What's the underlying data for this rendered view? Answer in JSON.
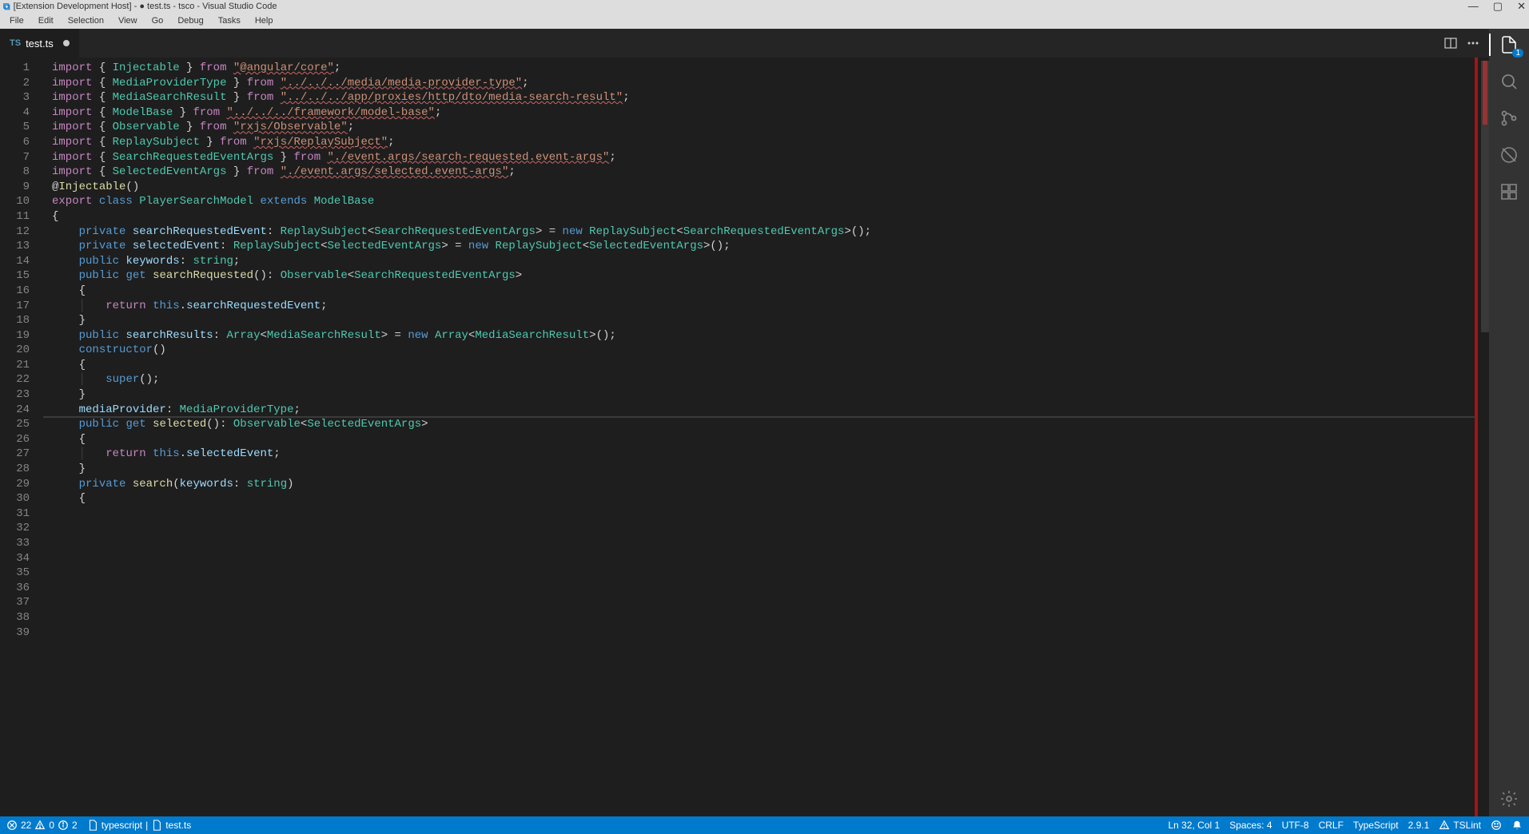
{
  "titlebar": {
    "title": "[Extension Development Host] - ● test.ts - tsco - Visual Studio Code"
  },
  "menubar": {
    "items": [
      "File",
      "Edit",
      "Selection",
      "View",
      "Go",
      "Debug",
      "Tasks",
      "Help"
    ]
  },
  "tabs": {
    "active": {
      "icon": "TS",
      "label": "test.ts",
      "dirty": true
    }
  },
  "activity": {
    "badge": "1"
  },
  "status": {
    "errors": "22",
    "warnings": "0",
    "infos": "2",
    "lang_mode": "typescript",
    "file": "test.ts",
    "cursor": "Ln 32, Col 1",
    "spaces": "Spaces: 4",
    "encoding": "UTF-8",
    "eol": "CRLF",
    "language": "TypeScript",
    "tsversion": "2.9.1",
    "tslint": "TSLint"
  },
  "code": {
    "lines": [
      {
        "n": "1",
        "segs": [
          [
            "kw",
            "import"
          ],
          [
            "pn",
            " { "
          ],
          [
            "cls",
            "Injectable"
          ],
          [
            "pn",
            " } "
          ],
          [
            "kw",
            "from"
          ],
          [
            "pn",
            " "
          ],
          [
            "str wavy",
            "\"@angular/core\""
          ],
          [
            "pn",
            ";"
          ]
        ]
      },
      {
        "n": "2",
        "segs": [
          [
            "kw",
            "import"
          ],
          [
            "pn",
            " { "
          ],
          [
            "cls",
            "MediaProviderType"
          ],
          [
            "pn",
            " } "
          ],
          [
            "kw",
            "from"
          ],
          [
            "pn",
            " "
          ],
          [
            "str wavy",
            "\"../../../media/media-provider-type\""
          ],
          [
            "pn",
            ";"
          ]
        ]
      },
      {
        "n": "3",
        "segs": [
          [
            "kw",
            "import"
          ],
          [
            "pn",
            " { "
          ],
          [
            "cls",
            "MediaSearchResult"
          ],
          [
            "pn",
            " } "
          ],
          [
            "kw",
            "from"
          ],
          [
            "pn",
            " "
          ],
          [
            "str wavy",
            "\"../../../app/proxies/http/dto/media-search-result\""
          ],
          [
            "pn",
            ";"
          ]
        ]
      },
      {
        "n": "4",
        "segs": [
          [
            "kw",
            "import"
          ],
          [
            "pn",
            " { "
          ],
          [
            "cls",
            "ModelBase"
          ],
          [
            "pn",
            " } "
          ],
          [
            "kw",
            "from"
          ],
          [
            "pn",
            " "
          ],
          [
            "str wavy",
            "\"../../../framework/model-base\""
          ],
          [
            "pn",
            ";"
          ]
        ]
      },
      {
        "n": "5",
        "segs": [
          [
            "kw",
            "import"
          ],
          [
            "pn",
            " { "
          ],
          [
            "cls",
            "Observable"
          ],
          [
            "pn",
            " } "
          ],
          [
            "kw",
            "from"
          ],
          [
            "pn",
            " "
          ],
          [
            "str wavy",
            "\"rxjs/Observable\""
          ],
          [
            "pn",
            ";"
          ]
        ]
      },
      {
        "n": "6",
        "segs": [
          [
            "kw",
            "import"
          ],
          [
            "pn",
            " { "
          ],
          [
            "cls",
            "ReplaySubject"
          ],
          [
            "pn",
            " } "
          ],
          [
            "kw",
            "from"
          ],
          [
            "pn",
            " "
          ],
          [
            "str wavy",
            "\"rxjs/ReplaySubject\""
          ],
          [
            "pn",
            ";"
          ]
        ]
      },
      {
        "n": "7",
        "segs": [
          [
            "kw",
            "import"
          ],
          [
            "pn",
            " { "
          ],
          [
            "cls",
            "SearchRequestedEventArgs"
          ],
          [
            "pn",
            " } "
          ],
          [
            "kw",
            "from"
          ],
          [
            "pn",
            " "
          ],
          [
            "str wavy",
            "\"./event.args/search-requested.event-args\""
          ],
          [
            "pn",
            ";"
          ]
        ]
      },
      {
        "n": "8",
        "segs": [
          [
            "kw",
            "import"
          ],
          [
            "pn",
            " { "
          ],
          [
            "cls",
            "SelectedEventArgs"
          ],
          [
            "pn",
            " } "
          ],
          [
            "kw",
            "from"
          ],
          [
            "pn",
            " "
          ],
          [
            "str wavy",
            "\"./event.args/selected.event-args\""
          ],
          [
            "pn",
            ";"
          ]
        ]
      },
      {
        "n": "9",
        "segs": [
          [
            "pn",
            ""
          ]
        ]
      },
      {
        "n": "10",
        "segs": [
          [
            "dec",
            "@"
          ],
          [
            "fn",
            "Injectable"
          ],
          [
            "pn",
            "()"
          ]
        ]
      },
      {
        "n": "11",
        "segs": [
          [
            "kw",
            "export"
          ],
          [
            "pn",
            " "
          ],
          [
            "typekey",
            "class"
          ],
          [
            "pn",
            " "
          ],
          [
            "cls wavy",
            "PlayerSearchModel"
          ],
          [
            "pn",
            " "
          ],
          [
            "typekey",
            "extends"
          ],
          [
            "pn",
            " "
          ],
          [
            "cls",
            "ModelBase"
          ]
        ]
      },
      {
        "n": "12",
        "segs": [
          [
            "pn",
            "{"
          ]
        ]
      },
      {
        "n": "13",
        "segs": [
          [
            "pn",
            "    "
          ],
          [
            "typekey",
            "private"
          ],
          [
            "pn",
            " "
          ],
          [
            "var",
            "searchRequestedEvent"
          ],
          [
            "pn",
            ": "
          ],
          [
            "cls",
            "ReplaySubject"
          ],
          [
            "pn",
            "<"
          ],
          [
            "cls",
            "SearchRequestedEventArgs"
          ],
          [
            "pn",
            "> = "
          ],
          [
            "typekey",
            "new"
          ],
          [
            "pn",
            " "
          ],
          [
            "cls",
            "ReplaySubject"
          ],
          [
            "pn",
            "<"
          ],
          [
            "cls",
            "SearchRequestedEventArgs"
          ],
          [
            "pn",
            ">();"
          ]
        ]
      },
      {
        "n": "14",
        "segs": [
          [
            "pn",
            ""
          ]
        ]
      },
      {
        "n": "15",
        "segs": [
          [
            "pn",
            "    "
          ],
          [
            "typekey",
            "private"
          ],
          [
            "pn",
            " "
          ],
          [
            "var",
            "selectedEvent"
          ],
          [
            "pn",
            ": "
          ],
          [
            "cls",
            "ReplaySubject"
          ],
          [
            "pn",
            "<"
          ],
          [
            "cls",
            "SelectedEventArgs"
          ],
          [
            "pn",
            "> = "
          ],
          [
            "typekey",
            "new"
          ],
          [
            "pn",
            " "
          ],
          [
            "cls",
            "ReplaySubject"
          ],
          [
            "pn",
            "<"
          ],
          [
            "cls",
            "SelectedEventArgs"
          ],
          [
            "pn",
            ">();"
          ]
        ]
      },
      {
        "n": "16",
        "segs": [
          [
            "pn",
            ""
          ]
        ]
      },
      {
        "n": "17",
        "segs": [
          [
            "pn",
            "    "
          ],
          [
            "typekey",
            "public"
          ],
          [
            "pn",
            " "
          ],
          [
            "var",
            "keywords"
          ],
          [
            "pn",
            ": "
          ],
          [
            "cls",
            "string"
          ],
          [
            "pn",
            ";"
          ]
        ]
      },
      {
        "n": "18",
        "segs": [
          [
            "pn",
            ""
          ]
        ]
      },
      {
        "n": "19",
        "segs": [
          [
            "pn",
            "    "
          ],
          [
            "typekey",
            "public"
          ],
          [
            "pn",
            " "
          ],
          [
            "typekey",
            "get"
          ],
          [
            "pn",
            " "
          ],
          [
            "fn",
            "searchRequested"
          ],
          [
            "pn",
            "(): "
          ],
          [
            "cls",
            "Observable"
          ],
          [
            "pn",
            "<"
          ],
          [
            "cls",
            "SearchRequestedEventArgs"
          ],
          [
            "pn",
            ">"
          ]
        ]
      },
      {
        "n": "20",
        "segs": [
          [
            "pn",
            "    {"
          ]
        ]
      },
      {
        "n": "21",
        "segs": [
          [
            "pn",
            "    "
          ],
          [
            "guide",
            "│"
          ],
          [
            "pn",
            "   "
          ],
          [
            "kw",
            "return"
          ],
          [
            "pn",
            " "
          ],
          [
            "typekey",
            "this"
          ],
          [
            "pn",
            "."
          ],
          [
            "var",
            "searchRequestedEvent"
          ],
          [
            "pn",
            ";"
          ]
        ]
      },
      {
        "n": "22",
        "segs": [
          [
            "pn",
            "    }"
          ]
        ]
      },
      {
        "n": "23",
        "segs": [
          [
            "pn",
            ""
          ]
        ]
      },
      {
        "n": "24",
        "segs": [
          [
            "pn",
            "    "
          ],
          [
            "typekey",
            "public"
          ],
          [
            "pn",
            " "
          ],
          [
            "var",
            "searchResults"
          ],
          [
            "pn",
            ": "
          ],
          [
            "cls",
            "Array"
          ],
          [
            "pn",
            "<"
          ],
          [
            "cls",
            "MediaSearchResult"
          ],
          [
            "pn",
            "> = "
          ],
          [
            "typekey",
            "new"
          ],
          [
            "pn",
            " "
          ],
          [
            "cls",
            "Array"
          ],
          [
            "pn",
            "<"
          ],
          [
            "cls",
            "MediaSearchResult"
          ],
          [
            "pn",
            ">();"
          ]
        ]
      },
      {
        "n": "25",
        "segs": [
          [
            "pn",
            ""
          ]
        ]
      },
      {
        "n": "26",
        "segs": [
          [
            "pn",
            "    "
          ],
          [
            "typekey",
            "constructor"
          ],
          [
            "pn",
            "()"
          ]
        ]
      },
      {
        "n": "27",
        "segs": [
          [
            "pn",
            "    {"
          ]
        ]
      },
      {
        "n": "28",
        "segs": [
          [
            "pn",
            "    "
          ],
          [
            "guide",
            "│"
          ],
          [
            "pn",
            "   "
          ],
          [
            "typekey",
            "super"
          ],
          [
            "pn",
            "();"
          ]
        ]
      },
      {
        "n": "29",
        "segs": [
          [
            "pn",
            "    }"
          ]
        ]
      },
      {
        "n": "30",
        "segs": [
          [
            "pn",
            ""
          ]
        ]
      },
      {
        "n": "31",
        "segs": [
          [
            "pn",
            "    "
          ],
          [
            "var",
            "mediaProvider"
          ],
          [
            "pn",
            ": "
          ],
          [
            "cls",
            "MediaProviderType"
          ],
          [
            "pn",
            ";"
          ]
        ]
      },
      {
        "n": "32",
        "segs": [
          [
            "pn",
            ""
          ]
        ],
        "current": true
      },
      {
        "n": "33",
        "segs": [
          [
            "pn",
            "    "
          ],
          [
            "typekey",
            "public"
          ],
          [
            "pn",
            " "
          ],
          [
            "typekey",
            "get"
          ],
          [
            "pn",
            " "
          ],
          [
            "fn",
            "selected"
          ],
          [
            "pn",
            "(): "
          ],
          [
            "cls",
            "Observable"
          ],
          [
            "pn",
            "<"
          ],
          [
            "cls",
            "SelectedEventArgs"
          ],
          [
            "pn",
            ">"
          ]
        ]
      },
      {
        "n": "34",
        "segs": [
          [
            "pn",
            "    {"
          ]
        ]
      },
      {
        "n": "35",
        "segs": [
          [
            "pn",
            "    "
          ],
          [
            "guide",
            "│"
          ],
          [
            "pn",
            "   "
          ],
          [
            "kw",
            "return"
          ],
          [
            "pn",
            " "
          ],
          [
            "typekey",
            "this"
          ],
          [
            "pn",
            "."
          ],
          [
            "var",
            "selectedEvent"
          ],
          [
            "pn",
            ";"
          ]
        ]
      },
      {
        "n": "36",
        "segs": [
          [
            "pn",
            "    }"
          ]
        ]
      },
      {
        "n": "37",
        "segs": [
          [
            "pn",
            ""
          ]
        ]
      },
      {
        "n": "38",
        "segs": [
          [
            "pn",
            "    "
          ],
          [
            "typekey",
            "private"
          ],
          [
            "pn",
            " "
          ],
          [
            "fn",
            "search"
          ],
          [
            "pn",
            "("
          ],
          [
            "var",
            "keywords"
          ],
          [
            "pn",
            ": "
          ],
          [
            "cls",
            "string"
          ],
          [
            "pn",
            ")"
          ]
        ]
      },
      {
        "n": "39",
        "segs": [
          [
            "pn",
            "    {"
          ]
        ]
      }
    ]
  }
}
